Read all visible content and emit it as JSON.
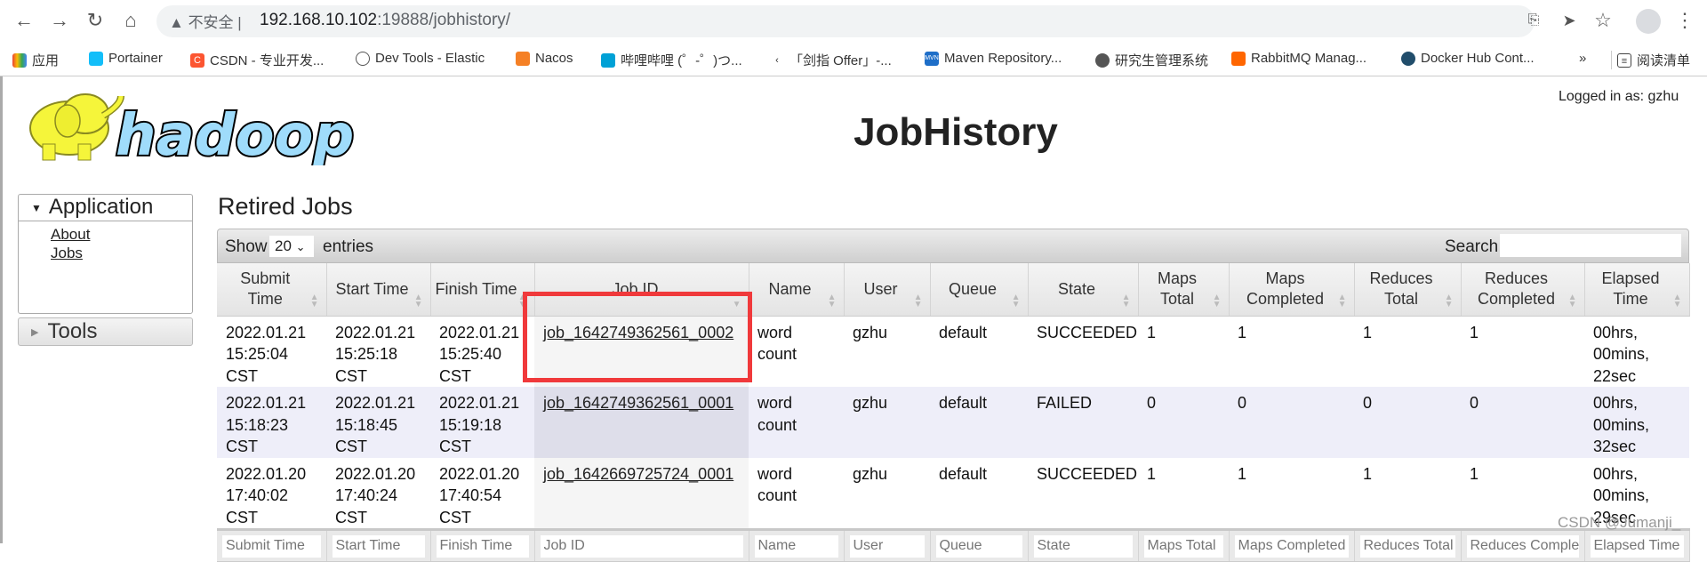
{
  "browser": {
    "security_label": "不安全",
    "url_host": "192.168.10.102",
    "url_rest": ":19888/jobhistory/",
    "bookmarks": [
      "应用",
      "Portainer",
      "CSDN - 专业开发...",
      "Dev Tools - Elastic",
      "Nacos",
      "哔哩哔哩 (゜-゜)つ...",
      "「剑指 Offer」-...",
      "Maven Repository...",
      "研究生管理系统",
      "RabbitMQ Manag...",
      "Docker Hub Cont..."
    ],
    "more_label": "»",
    "reading_list": "阅读清单"
  },
  "header": {
    "logo_text": "hadoop",
    "title": "JobHistory",
    "logged_in": "Logged in as: gzhu"
  },
  "sidebar": {
    "application": "Application",
    "links": [
      "About",
      "Jobs"
    ],
    "tools": "Tools"
  },
  "main": {
    "heading": "Retired Jobs",
    "show_label": "Show",
    "page_length": "20",
    "entries_label": "entries",
    "search_label": "Search:",
    "columns": [
      [
        "Submit",
        "Time"
      ],
      [
        "Start Time",
        ""
      ],
      [
        "Finish Time",
        ""
      ],
      [
        "Job ID",
        ""
      ],
      [
        "Name",
        ""
      ],
      [
        "User",
        ""
      ],
      [
        "Queue",
        ""
      ],
      [
        "State",
        ""
      ],
      [
        "Maps",
        "Total"
      ],
      [
        "Maps",
        "Completed"
      ],
      [
        "Reduces",
        "Total"
      ],
      [
        "Reduces",
        "Completed"
      ],
      [
        "Elapsed",
        "Time"
      ]
    ],
    "rows": [
      {
        "submit": [
          "2022.01.21",
          "15:25:04",
          "CST"
        ],
        "start": [
          "2022.01.21",
          "15:25:18",
          "CST"
        ],
        "finish": [
          "2022.01.21",
          "15:25:40",
          "CST"
        ],
        "job_id": "job_1642749362561_0002",
        "name": [
          "word",
          "count"
        ],
        "user": "gzhu",
        "queue": "default",
        "state": "SUCCEEDED",
        "maps_total": "1",
        "maps_completed": "1",
        "reduces_total": "1",
        "reduces_completed": "1",
        "elapsed": [
          "00hrs,",
          "00mins,",
          "22sec"
        ]
      },
      {
        "submit": [
          "2022.01.21",
          "15:18:23",
          "CST"
        ],
        "start": [
          "2022.01.21",
          "15:18:45",
          "CST"
        ],
        "finish": [
          "2022.01.21",
          "15:19:18",
          "CST"
        ],
        "job_id": "job_1642749362561_0001",
        "name": [
          "word",
          "count"
        ],
        "user": "gzhu",
        "queue": "default",
        "state": "FAILED",
        "maps_total": "0",
        "maps_completed": "0",
        "reduces_total": "0",
        "reduces_completed": "0",
        "elapsed": [
          "00hrs,",
          "00mins,",
          "32sec"
        ]
      },
      {
        "submit": [
          "2022.01.20",
          "17:40:02",
          "CST"
        ],
        "start": [
          "2022.01.20",
          "17:40:24",
          "CST"
        ],
        "finish": [
          "2022.01.20",
          "17:40:54",
          "CST"
        ],
        "job_id": "job_1642669725724_0001",
        "name": [
          "word",
          "count"
        ],
        "user": "gzhu",
        "queue": "default",
        "state": "SUCCEEDED",
        "maps_total": "1",
        "maps_completed": "1",
        "reduces_total": "1",
        "reduces_completed": "1",
        "elapsed": [
          "00hrs,",
          "00mins,",
          "29sec"
        ]
      }
    ],
    "filter_placeholders": [
      "Submit Time",
      "Start Time",
      "Finish Time",
      "Job ID",
      "Name",
      "User",
      "Queue",
      "State",
      "Maps Total",
      "Maps Completed",
      "Reduces Total",
      "Reduces Completed",
      "Elapsed Time"
    ]
  },
  "annotation_color": "#f0393b",
  "watermark": "CSDN @Jumanji_"
}
